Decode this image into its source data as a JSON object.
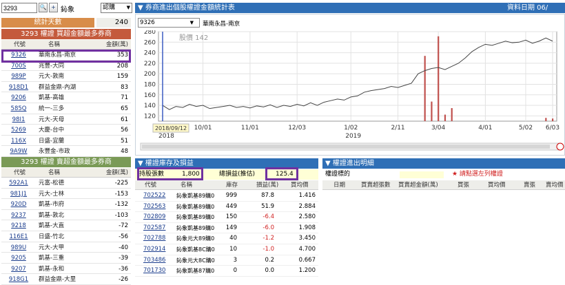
{
  "topbar": {
    "code": "3293",
    "search_btn": "🔍",
    "add_btn": "+",
    "label": "鈊象",
    "type_select": "認購"
  },
  "stats": {
    "days_label": "統計天數",
    "days_value": "240"
  },
  "buy_table": {
    "title": "3293 權證 買超金額最多券商",
    "headers": [
      "代號",
      "名稱",
      "金額(萬)"
    ],
    "rows": [
      {
        "code": "9326",
        "name": "華南永昌-南京",
        "amount": "353"
      },
      {
        "code": "700S",
        "name": "兆豐-大同",
        "amount": "208"
      },
      {
        "code": "989P",
        "name": "元大-敦南",
        "amount": "159"
      },
      {
        "code": "918D1",
        "name": "群益金鼎-內湖",
        "amount": "83"
      },
      {
        "code": "9206",
        "name": "凱基-高雄",
        "amount": "71"
      },
      {
        "code": "585Q",
        "name": "統一-三多",
        "amount": "65"
      },
      {
        "code": "98I1",
        "name": "元大-天母",
        "amount": "61"
      },
      {
        "code": "5269",
        "name": "大慶-台中",
        "amount": "56"
      },
      {
        "code": "116X",
        "name": "日盛-宜蘭",
        "amount": "51"
      },
      {
        "code": "9A9W",
        "name": "永豐金-市政",
        "amount": "48"
      }
    ]
  },
  "sell_table": {
    "title": "3293 權證 賣超金額最多券商",
    "headers": [
      "代號",
      "名稱",
      "金額(萬)"
    ],
    "rows": [
      {
        "code": "592A1",
        "name": "元富-松德",
        "amount": "-225"
      },
      {
        "code": "981J1",
        "name": "元大-士林",
        "amount": "-153"
      },
      {
        "code": "920D",
        "name": "凱基-市府",
        "amount": "-132"
      },
      {
        "code": "9237",
        "name": "凱基-敦北",
        "amount": "-103"
      },
      {
        "code": "9218",
        "name": "凱基-大直",
        "amount": "-72"
      },
      {
        "code": "116E1",
        "name": "日盛-竹北",
        "amount": "-56"
      },
      {
        "code": "989U",
        "name": "元大-大甲",
        "amount": "-40"
      },
      {
        "code": "9205",
        "name": "凱基-三重",
        "amount": "-39"
      },
      {
        "code": "9207",
        "name": "凱基-永和",
        "amount": "-36"
      },
      {
        "code": "918G1",
        "name": "群益金鼎-大里",
        "amount": "-26"
      }
    ]
  },
  "chart_panel": {
    "title": "▼ 券商進出個股權證金額統計表",
    "date_label": "資料日期 06/",
    "broker_code": "9326",
    "broker_name": "華南永昌-南京",
    "price_label": "股價 142",
    "cursor_date": "2018/09/12",
    "year_2018": "2018",
    "year_2019": "2019"
  },
  "chart_data": {
    "type": "line",
    "ylim": [
      110,
      280
    ],
    "yticks": [
      "280",
      "260",
      "240",
      "220",
      "200",
      "180",
      "160",
      "140",
      "120"
    ],
    "xticks": [
      "10/01",
      "11/01",
      "12/03",
      "1/02",
      "2/11",
      "3/04",
      "4/01",
      "5/02",
      "6/03"
    ],
    "series": [
      {
        "values": [
          140,
          132,
          138,
          136,
          142,
          138,
          140,
          134,
          136,
          138,
          140,
          136,
          138,
          135,
          139,
          137,
          141,
          136,
          140,
          138,
          142,
          139,
          145,
          140,
          146,
          149,
          152,
          150,
          156,
          158,
          165,
          168,
          170,
          172,
          176,
          174,
          178,
          182,
          200,
          206,
          210,
          212,
          208,
          214,
          220,
          230,
          242,
          250,
          256,
          254,
          258,
          262,
          259,
          260,
          264,
          258,
          262,
          268,
          262
        ]
      }
    ],
    "bars": [
      0,
      0,
      0,
      0,
      0,
      0,
      0,
      0,
      0,
      0,
      0,
      0,
      0,
      0,
      0,
      0,
      0,
      0,
      0,
      0,
      0,
      0,
      0,
      0,
      0,
      0,
      0,
      0,
      0,
      0,
      0,
      0,
      0,
      0,
      0,
      0,
      0,
      0,
      0,
      200,
      60,
      260,
      20,
      40,
      0,
      0,
      0,
      0,
      0,
      0,
      0,
      0,
      0,
      0,
      0,
      0,
      0,
      10,
      8
    ]
  },
  "holdings": {
    "title": "▼ 權證庫存及損益",
    "shares_label": "持股張數",
    "shares_value": "1,800",
    "pnl_label": "總損益(推估)",
    "pnl_value": "125.4",
    "headers": [
      "代號",
      "名稱",
      "庫存",
      "損益(萬)",
      "買均價"
    ],
    "rows": [
      {
        "code": "702522",
        "name": "鈊象凱基89購0",
        "qty": "999",
        "pnl": "87.8",
        "avg": "1.416"
      },
      {
        "code": "702563",
        "name": "鈊象凱基89購0",
        "qty": "449",
        "pnl": "51.9",
        "avg": "2.884"
      },
      {
        "code": "702809",
        "name": "鈊象凱基89購0",
        "qty": "150",
        "pnl": "-6.4",
        "avg": "2.580"
      },
      {
        "code": "702587",
        "name": "鈊象凱基89購0",
        "qty": "149",
        "pnl": "-6.0",
        "avg": "1.908"
      },
      {
        "code": "702788",
        "name": "鈊象元大89購0",
        "qty": "40",
        "pnl": "-1.2",
        "avg": "3.450"
      },
      {
        "code": "702914",
        "name": "鈊象凱基8C購0",
        "qty": "10",
        "pnl": "-1.0",
        "avg": "4.700"
      },
      {
        "code": "703486",
        "name": "鈊象元大8C購0",
        "qty": "3",
        "pnl": "0.2",
        "avg": "0.667"
      },
      {
        "code": "701730",
        "name": "鈊象凱基87購0",
        "qty": "0",
        "pnl": "0.0",
        "avg": "1.200"
      }
    ]
  },
  "detail": {
    "title": "▼ 權證進出明細",
    "target_label": "權證標的",
    "hint": "★ 請點選左列權證",
    "headers": [
      "日期",
      "買賣超張數",
      "買賣超金額(萬)",
      "買張",
      "買均價",
      "賣張",
      "賣均價"
    ]
  }
}
